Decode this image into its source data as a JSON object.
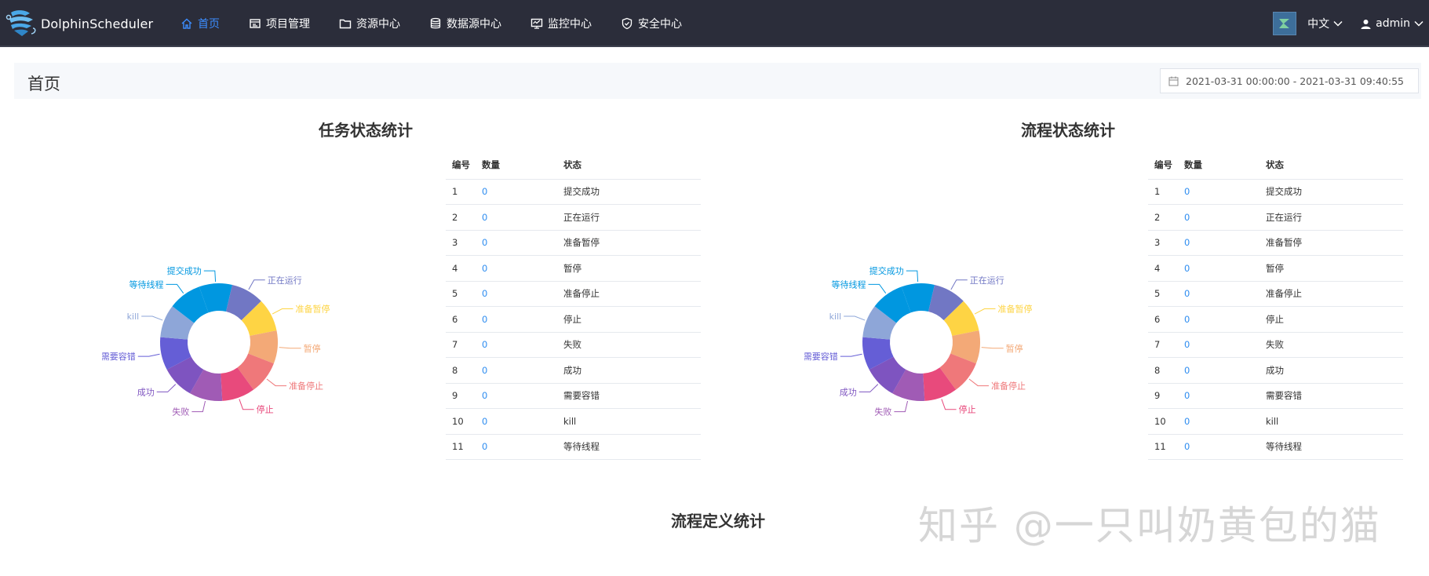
{
  "app": {
    "name": "DolphinScheduler"
  },
  "nav": [
    {
      "label": "首页",
      "icon": "home-icon",
      "active": true
    },
    {
      "label": "项目管理",
      "icon": "project-icon",
      "active": false
    },
    {
      "label": "资源中心",
      "icon": "folder-icon",
      "active": false
    },
    {
      "label": "数据源中心",
      "icon": "database-icon",
      "active": false
    },
    {
      "label": "监控中心",
      "icon": "monitor-icon",
      "active": false
    },
    {
      "label": "安全中心",
      "icon": "shield-icon",
      "active": false
    }
  ],
  "header_right": {
    "language": "中文",
    "user": "admin"
  },
  "page": {
    "title": "首页",
    "date_range": "2021-03-31 00:00:00 - 2021-03-31 09:40:55"
  },
  "task_section": {
    "title": "任务状态统计"
  },
  "process_section": {
    "title": "流程状态统计"
  },
  "definition_section": {
    "title": "流程定义统计"
  },
  "table_headers": {
    "index": "编号",
    "count": "数量",
    "status": "状态"
  },
  "task_rows": [
    {
      "index": "1",
      "count": "0",
      "status": "提交成功"
    },
    {
      "index": "2",
      "count": "0",
      "status": "正在运行"
    },
    {
      "index": "3",
      "count": "0",
      "status": "准备暂停"
    },
    {
      "index": "4",
      "count": "0",
      "status": "暂停"
    },
    {
      "index": "5",
      "count": "0",
      "status": "准备停止"
    },
    {
      "index": "6",
      "count": "0",
      "status": "停止"
    },
    {
      "index": "7",
      "count": "0",
      "status": "失败"
    },
    {
      "index": "8",
      "count": "0",
      "status": "成功"
    },
    {
      "index": "9",
      "count": "0",
      "status": "需要容错"
    },
    {
      "index": "10",
      "count": "0",
      "status": "kill"
    },
    {
      "index": "11",
      "count": "0",
      "status": "等待线程"
    }
  ],
  "process_rows": [
    {
      "index": "1",
      "count": "0",
      "status": "提交成功"
    },
    {
      "index": "2",
      "count": "0",
      "status": "正在运行"
    },
    {
      "index": "3",
      "count": "0",
      "status": "准备暂停"
    },
    {
      "index": "4",
      "count": "0",
      "status": "暂停"
    },
    {
      "index": "5",
      "count": "0",
      "status": "准备停止"
    },
    {
      "index": "6",
      "count": "0",
      "status": "停止"
    },
    {
      "index": "7",
      "count": "0",
      "status": "失败"
    },
    {
      "index": "8",
      "count": "0",
      "status": "成功"
    },
    {
      "index": "9",
      "count": "0",
      "status": "需要容错"
    },
    {
      "index": "10",
      "count": "0",
      "status": "kill"
    },
    {
      "index": "11",
      "count": "0",
      "status": "等待线程"
    }
  ],
  "chart_data": [
    {
      "type": "pie",
      "donut": true,
      "categories": [
        "提交成功",
        "正在运行",
        "准备暂停",
        "暂停",
        "准备停止",
        "停止",
        "失败",
        "成功",
        "需要容错",
        "kill",
        "等待线程"
      ],
      "values": [
        0,
        0,
        0,
        0,
        0,
        0,
        0,
        0,
        0,
        0,
        0
      ],
      "colors": [
        "#0097e0",
        "#7177c4",
        "#fed444",
        "#f3a977",
        "#ef787a",
        "#e84a7c",
        "#a05bb5",
        "#7e54c0",
        "#655ed6",
        "#8ea6d8",
        "#0097e0"
      ]
    },
    {
      "type": "pie",
      "donut": true,
      "categories": [
        "提交成功",
        "正在运行",
        "准备暂停",
        "暂停",
        "准备停止",
        "停止",
        "失败",
        "成功",
        "需要容错",
        "kill",
        "等待线程"
      ],
      "values": [
        0,
        0,
        0,
        0,
        0,
        0,
        0,
        0,
        0,
        0,
        0
      ],
      "colors": [
        "#0097e0",
        "#7177c4",
        "#fed444",
        "#f3a977",
        "#ef787a",
        "#e84a7c",
        "#a05bb5",
        "#7e54c0",
        "#655ed6",
        "#8ea6d8",
        "#0097e0"
      ]
    }
  ],
  "watermark": "知乎 @一只叫奶黄包的猫"
}
